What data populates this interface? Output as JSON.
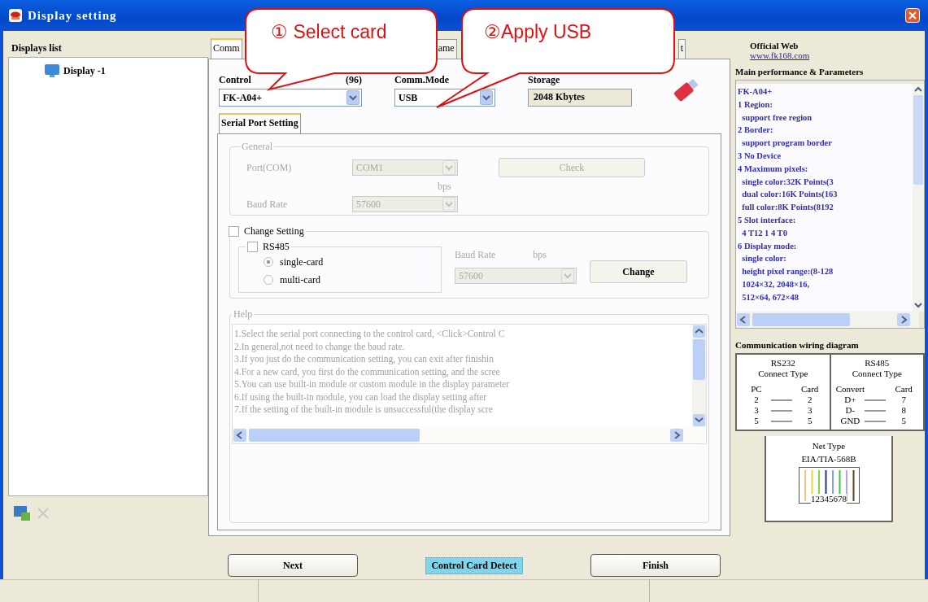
{
  "window": {
    "title": "Display setting"
  },
  "displays_list": {
    "header": "Displays list",
    "items": [
      {
        "label": "Display -1",
        "selected": false
      }
    ],
    "remove_disabled": true
  },
  "tabs": [
    {
      "label": "Comm",
      "selected": true
    },
    {
      "label": "ame",
      "selected": false
    },
    {
      "label": "t",
      "selected": false
    }
  ],
  "control_card": {
    "label": "Control",
    "count": "(96)",
    "value": "FK-A04+"
  },
  "comm_mode": {
    "label": "Comm.Mode",
    "value": "USB"
  },
  "storage": {
    "label": "Storage",
    "value": "2048 Kbytes"
  },
  "sub_tabs": [
    {
      "label": "Serial Port Setting",
      "selected": true
    }
  ],
  "general": {
    "title": "General",
    "disabled": true,
    "port_label": "Port(COM)",
    "port_value": "COM1",
    "check_button": "Check",
    "unit": "bps",
    "baud_label": "Baud Rate",
    "baud_value": "57600"
  },
  "change_setting": {
    "label": "Change Setting",
    "checked": false,
    "rs485_label": "RS485",
    "rs485_checked": false,
    "modes": [
      {
        "label": "single-card",
        "selected": true
      },
      {
        "label": "multi-card",
        "selected": false
      }
    ],
    "baud_label": "Baud Rate",
    "unit": "bps",
    "baud_value": "57600",
    "button": "Change"
  },
  "help": {
    "title": "Help",
    "lines": [
      "1.Select the serial port connecting to the control card, <Click>Control C",
      "2.In general,not need to change the baud rate.",
      "3.If you just do the communication setting, you can exit after finishin",
      "4.For a new card, you first do the communication setting, and the scree",
      "5.You can use built-in module or custom module in the display parameter",
      "6.If using the built-in module, you can load the display setting after",
      "7.If the setting of the built-in module is unsuccessful(the display scre"
    ]
  },
  "buttons": [
    {
      "label": "Next",
      "kind": "normal"
    },
    {
      "label": "Control Card Detect",
      "kind": "highlight"
    },
    {
      "label": "Finish",
      "kind": "normal"
    }
  ],
  "info": {
    "web_label": "Official Web",
    "web_link": "www.fk168.com",
    "params_title": "Main performance & Parameters",
    "params_lines": [
      "FK-A04+",
      "1 Region:",
      "  support free region",
      "2 Border:",
      "  support program border",
      "3 No Device",
      "4 Maximum pixels:",
      "  single color:32K Points(3",
      "  dual color:16K Points(163",
      "  full color:8K Points(8192",
      "5 Slot interface:",
      "  4 T12 1 4 T0",
      "6 Display mode:",
      "  single color:",
      "  height pixel range:(8-128",
      "  1024×32, 2048×16,",
      "  512×64, 672×48"
    ],
    "wiring_title": "Communication wiring diagram",
    "wiring": [
      {
        "title": "RS232",
        "subtitle": "Connect Type",
        "columns": [
          "PC",
          "Card"
        ],
        "rows": [
          [
            "2",
            "2"
          ],
          [
            "3",
            "3"
          ],
          [
            "5",
            "5"
          ]
        ]
      },
      {
        "title": "RS485",
        "subtitle": "Connect Type",
        "columns": [
          "Convert",
          "Card"
        ],
        "rows": [
          [
            "D+",
            "7"
          ],
          [
            "D-",
            "8"
          ],
          [
            "GND",
            "5"
          ]
        ]
      }
    ],
    "net": {
      "title": "Net Type",
      "standard": "EIA/TIA-568B",
      "pins": "12345678"
    }
  },
  "callouts": [
    {
      "text": "① Select card"
    },
    {
      "text": "②Apply USB"
    }
  ]
}
